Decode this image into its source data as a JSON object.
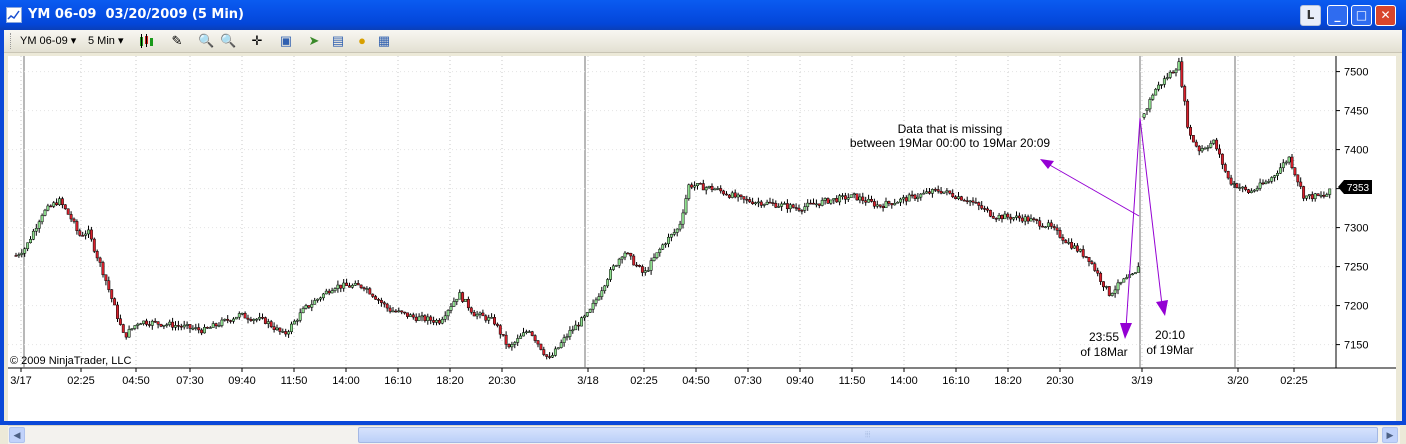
{
  "window": {
    "title": "YM 06-09  03/20/2009 (5 Min)",
    "buttons": {
      "restore_label": "L",
      "minimize_label": "_",
      "maximize_label": "□",
      "close_label": "✕"
    }
  },
  "toolbar": {
    "instrument": "YM 06-09",
    "interval": "5 Min",
    "icons": [
      "candlestick-icon",
      "draw-pencil-icon",
      "zoom-in-icon",
      "zoom-out-icon",
      "crosshair-icon",
      "properties-icon",
      "instrument-icon",
      "indicators-icon",
      "strategy-icon",
      "data-box-icon"
    ]
  },
  "chart": {
    "copyright": "© 2009 NinjaTrader, LLC",
    "last_price_label": "7353",
    "y_ticks": [
      "7500",
      "7450",
      "7400",
      "7350",
      "7300",
      "7250",
      "7200",
      "7150"
    ],
    "x_ticks": [
      "3/17",
      "02:25",
      "04:50",
      "07:30",
      "09:40",
      "11:50",
      "14:00",
      "16:10",
      "18:20",
      "20:30",
      "3/18",
      "02:25",
      "04:50",
      "07:30",
      "09:40",
      "11:50",
      "14:00",
      "16:10",
      "18:20",
      "20:30",
      "3/19",
      "3/20",
      "02:25"
    ],
    "annotations": {
      "missing_line1": "Data that is missing",
      "missing_line2": "between 19Mar 00:00 to 19Mar 20:09",
      "left_time": "23:55",
      "left_date": "of 18Mar",
      "right_time": "20:10",
      "right_date": "of 19Mar"
    },
    "colors": {
      "up": "#90e090",
      "down": "#d8202c",
      "annotation": "#9400d3",
      "price_marker": "#000000"
    }
  },
  "chart_data": {
    "type": "candlestick",
    "title": "YM 06-09 03/20/2009 (5 Min)",
    "ylim": [
      7120,
      7520
    ],
    "path": [
      [
        0,
        7285
      ],
      [
        8,
        7260
      ],
      [
        22,
        7275
      ],
      [
        38,
        7318
      ],
      [
        55,
        7335
      ],
      [
        68,
        7310
      ],
      [
        75,
        7290
      ],
      [
        84,
        7295
      ],
      [
        100,
        7240
      ],
      [
        120,
        7160
      ],
      [
        135,
        7180
      ],
      [
        170,
        7175
      ],
      [
        200,
        7168
      ],
      [
        235,
        7188
      ],
      [
        262,
        7180
      ],
      [
        280,
        7162
      ],
      [
        300,
        7195
      ],
      [
        330,
        7225
      ],
      [
        360,
        7225
      ],
      [
        385,
        7195
      ],
      [
        410,
        7185
      ],
      [
        435,
        7180
      ],
      [
        455,
        7215
      ],
      [
        470,
        7190
      ],
      [
        490,
        7180
      ],
      [
        505,
        7145
      ],
      [
        525,
        7170
      ],
      [
        545,
        7130
      ],
      [
        565,
        7165
      ],
      [
        585,
        7190
      ],
      [
        605,
        7240
      ],
      [
        620,
        7270
      ],
      [
        640,
        7240
      ],
      [
        660,
        7280
      ],
      [
        675,
        7300
      ],
      [
        685,
        7355
      ],
      [
        710,
        7350
      ],
      [
        740,
        7335
      ],
      [
        760,
        7332
      ],
      [
        795,
        7325
      ],
      [
        825,
        7335
      ],
      [
        850,
        7340
      ],
      [
        875,
        7328
      ],
      [
        905,
        7338
      ],
      [
        935,
        7348
      ],
      [
        965,
        7335
      ],
      [
        990,
        7315
      ],
      [
        1020,
        7312
      ],
      [
        1045,
        7302
      ],
      [
        1065,
        7280
      ],
      [
        1085,
        7260
      ],
      [
        1105,
        7215
      ],
      [
        1120,
        7232
      ],
      [
        1134,
        7242
      ],
      [
        1140,
        7445
      ],
      [
        1150,
        7475
      ],
      [
        1175,
        7510
      ],
      [
        1185,
        7420
      ],
      [
        1195,
        7400
      ],
      [
        1210,
        7410
      ],
      [
        1225,
        7360
      ],
      [
        1245,
        7345
      ],
      [
        1265,
        7360
      ],
      [
        1285,
        7390
      ],
      [
        1300,
        7340
      ],
      [
        1320,
        7340
      ],
      [
        1330,
        7350
      ]
    ]
  }
}
